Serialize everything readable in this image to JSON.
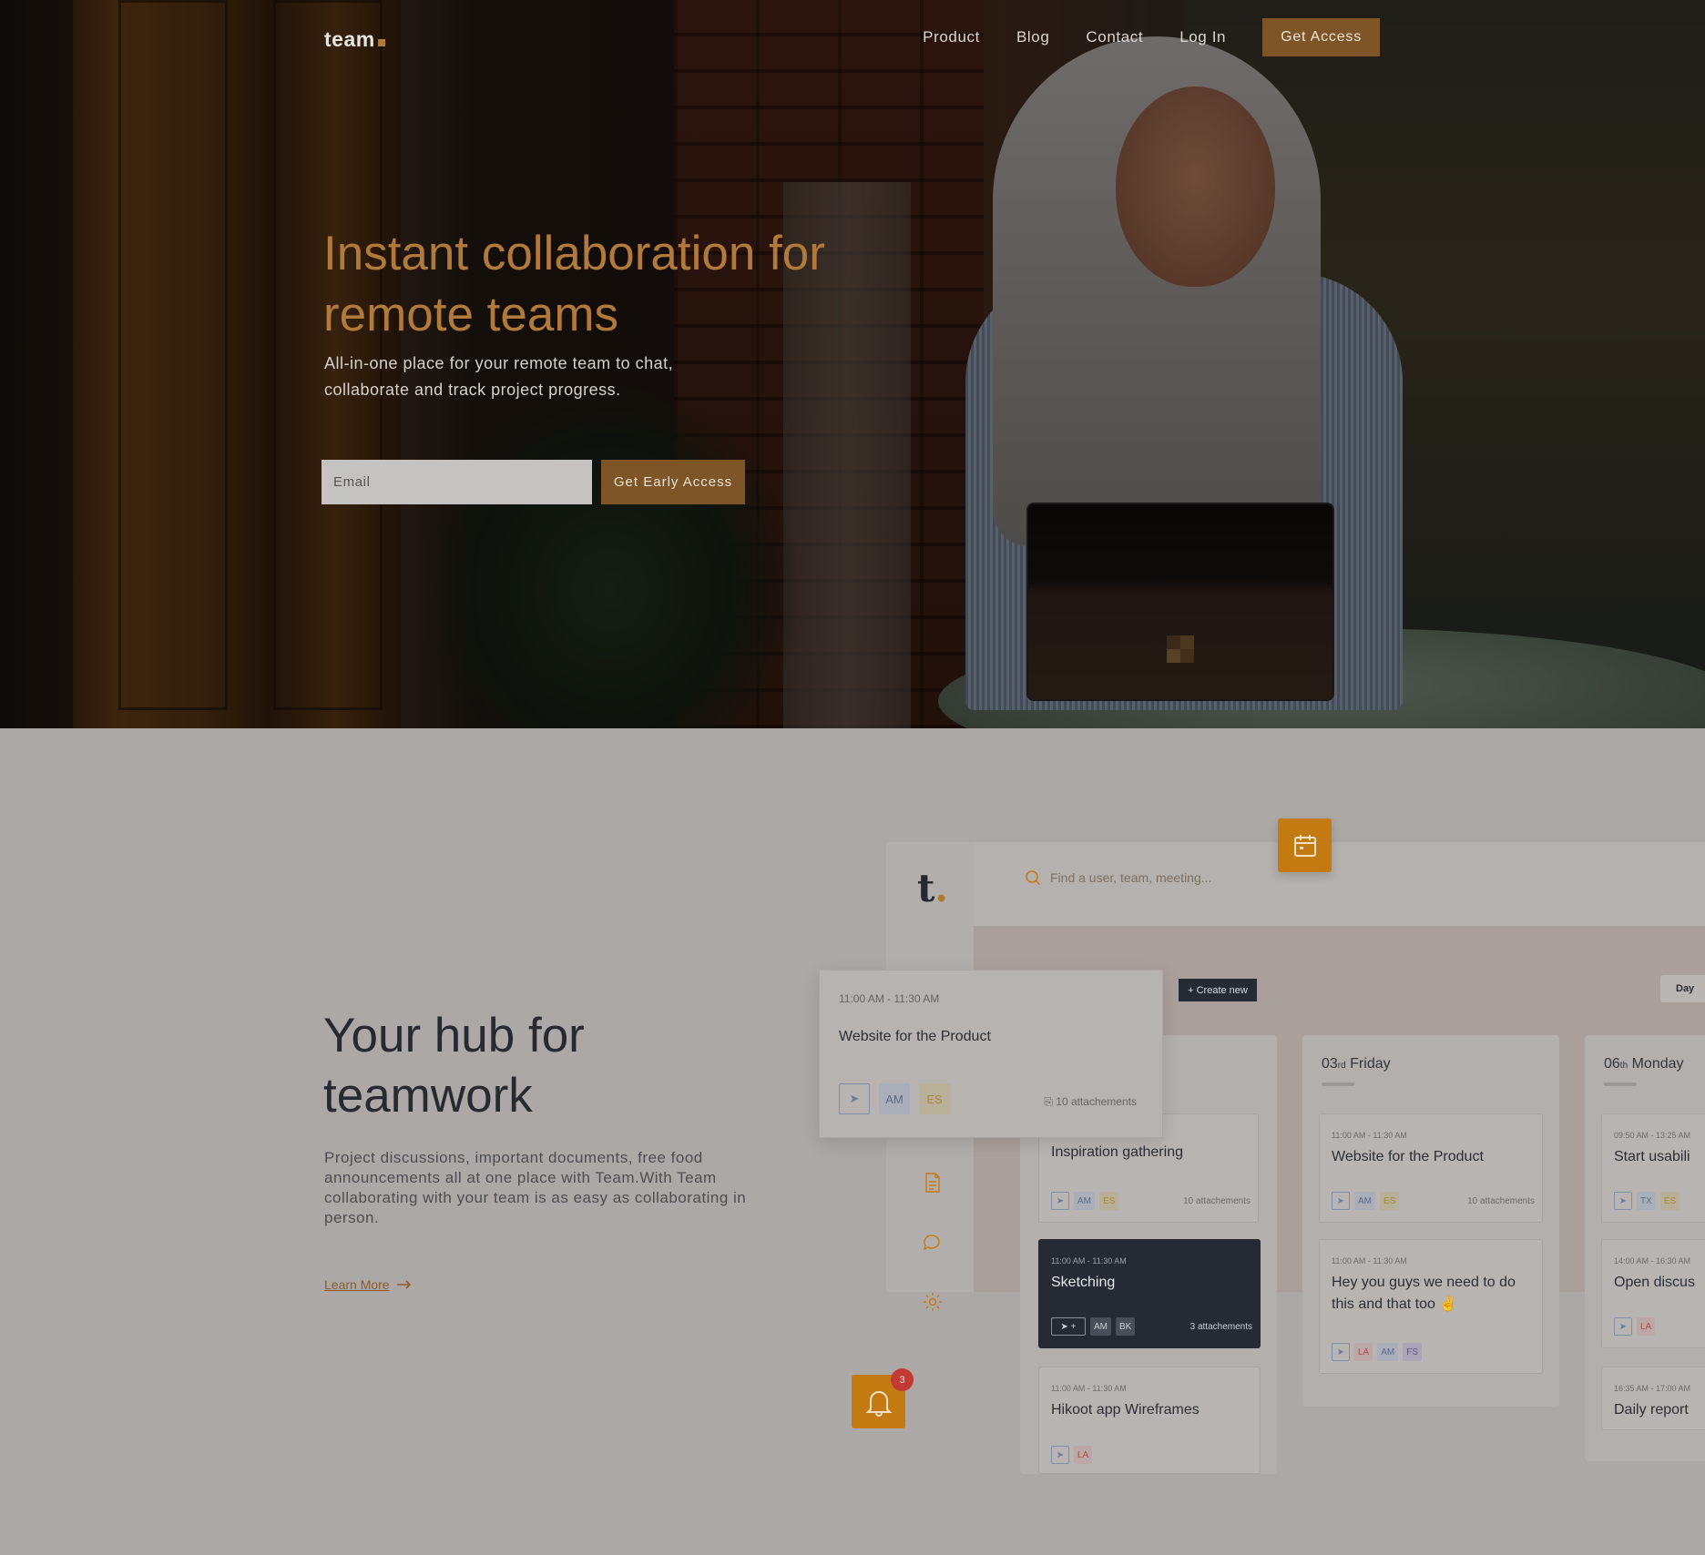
{
  "nav": {
    "logo": "team",
    "links": [
      "Product",
      "Blog",
      "Contact",
      "Log In"
    ],
    "cta": "Get Access"
  },
  "hero": {
    "title": "Instant collaboration for remote teams",
    "subtitle": "All-in-one place for your remote team to chat, collaborate and track project progress.",
    "email_placeholder": "Email",
    "button": "Get Early Access"
  },
  "section2": {
    "title": "Your hub for teamwork",
    "text": "Project discussions, important documents, free food announcements all at one place with Team.With Team collaborating with your team is as easy as collaborating in person.",
    "learn_more": "Learn More"
  },
  "app": {
    "logo": "t",
    "search_placeholder": "Find a user, team, meeting...",
    "create_new": "+ Create new",
    "view_toggle": "Day",
    "notification_count": "3",
    "popup": {
      "time": "11:00 AM - 11:30 AM",
      "title": "Website for the Product",
      "chips": [
        "AM",
        "ES"
      ],
      "attachments": "10 attachements"
    },
    "columns": [
      {
        "day_num": "",
        "day_suffix": "",
        "day_name": "",
        "cards": [
          {
            "time": "",
            "title": "Inspiration gathering",
            "chips": [
              "AM",
              "ES"
            ],
            "attachments": "10 attachements"
          },
          {
            "time": "11:00 AM - 11:30 AM",
            "title": "Sketching",
            "chips": [
              "AM",
              "BK"
            ],
            "attachments": "3 attachements"
          },
          {
            "time": "11:00 AM - 11:30 AM",
            "title": "Hikoot app Wireframes",
            "chips": [
              "LA"
            ],
            "attachments": ""
          }
        ]
      },
      {
        "day_num": "03",
        "day_suffix": "rd",
        "day_name": "Friday",
        "cards": [
          {
            "time": "11:00 AM - 11:30 AM",
            "title": "Website for the Product",
            "chips": [
              "AM",
              "ES"
            ],
            "attachments": "10 attachements"
          },
          {
            "time": "11:00 AM - 11:30 AM",
            "title": "Hey you guys we need to do this and that too ✌",
            "chips": [
              "LA",
              "AM",
              "FS"
            ],
            "attachments": ""
          }
        ]
      },
      {
        "day_num": "06",
        "day_suffix": "th",
        "day_name": "Monday",
        "cards": [
          {
            "time": "09:50 AM - 13:25 AM",
            "title": "Start usabili",
            "chips": [
              "TX",
              "ES"
            ],
            "attachments": ""
          },
          {
            "time": "14:00 AM - 16:30 AM",
            "title": "Open discus",
            "chips": [
              "LA"
            ],
            "attachments": ""
          },
          {
            "time": "16:35 AM - 17:00 AM",
            "title": "Daily report",
            "chips": [],
            "attachments": ""
          }
        ]
      }
    ]
  }
}
